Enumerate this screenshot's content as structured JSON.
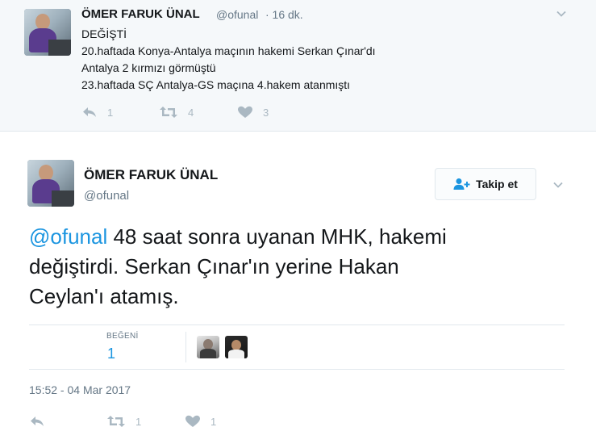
{
  "parent_tweet": {
    "author_name": "ÖMER FARUK ÜNAL",
    "handle": "@ofunal",
    "time": "· 16 dk.",
    "lines": [
      "DEĞİŞTİ",
      "20.haftada Konya-Antalya maçının hakemi Serkan Çınar'dı",
      "Antalya 2 kırmızı görmüştü",
      "23.haftada SÇ Antalya-GS maçına 4.hakem atanmıştı"
    ],
    "reply_count": "1",
    "retweet_count": "4",
    "like_count": "3"
  },
  "main_tweet": {
    "author_name": "ÖMER FARUK ÜNAL",
    "handle": "@ofunal",
    "follow_label": "Takip et",
    "mention": "@ofunal",
    "text_line1": " 48 saat sonra uyanan MHK, hakemi",
    "text_line2": "değiştirdi. Serkan Çınar'ın yerine Hakan",
    "text_line3": "Ceylan'ı atamış.",
    "likes_label": "BEĞENİ",
    "likes_value": "1",
    "timestamp": "15:52 - 04 Mar 2017",
    "retweet_count": "1",
    "like_count": "1"
  },
  "colors": {
    "accent": "#1b95e0",
    "muted": "#657786",
    "icon": "#aab8c2",
    "parent_bg": "#f5f8fa"
  }
}
